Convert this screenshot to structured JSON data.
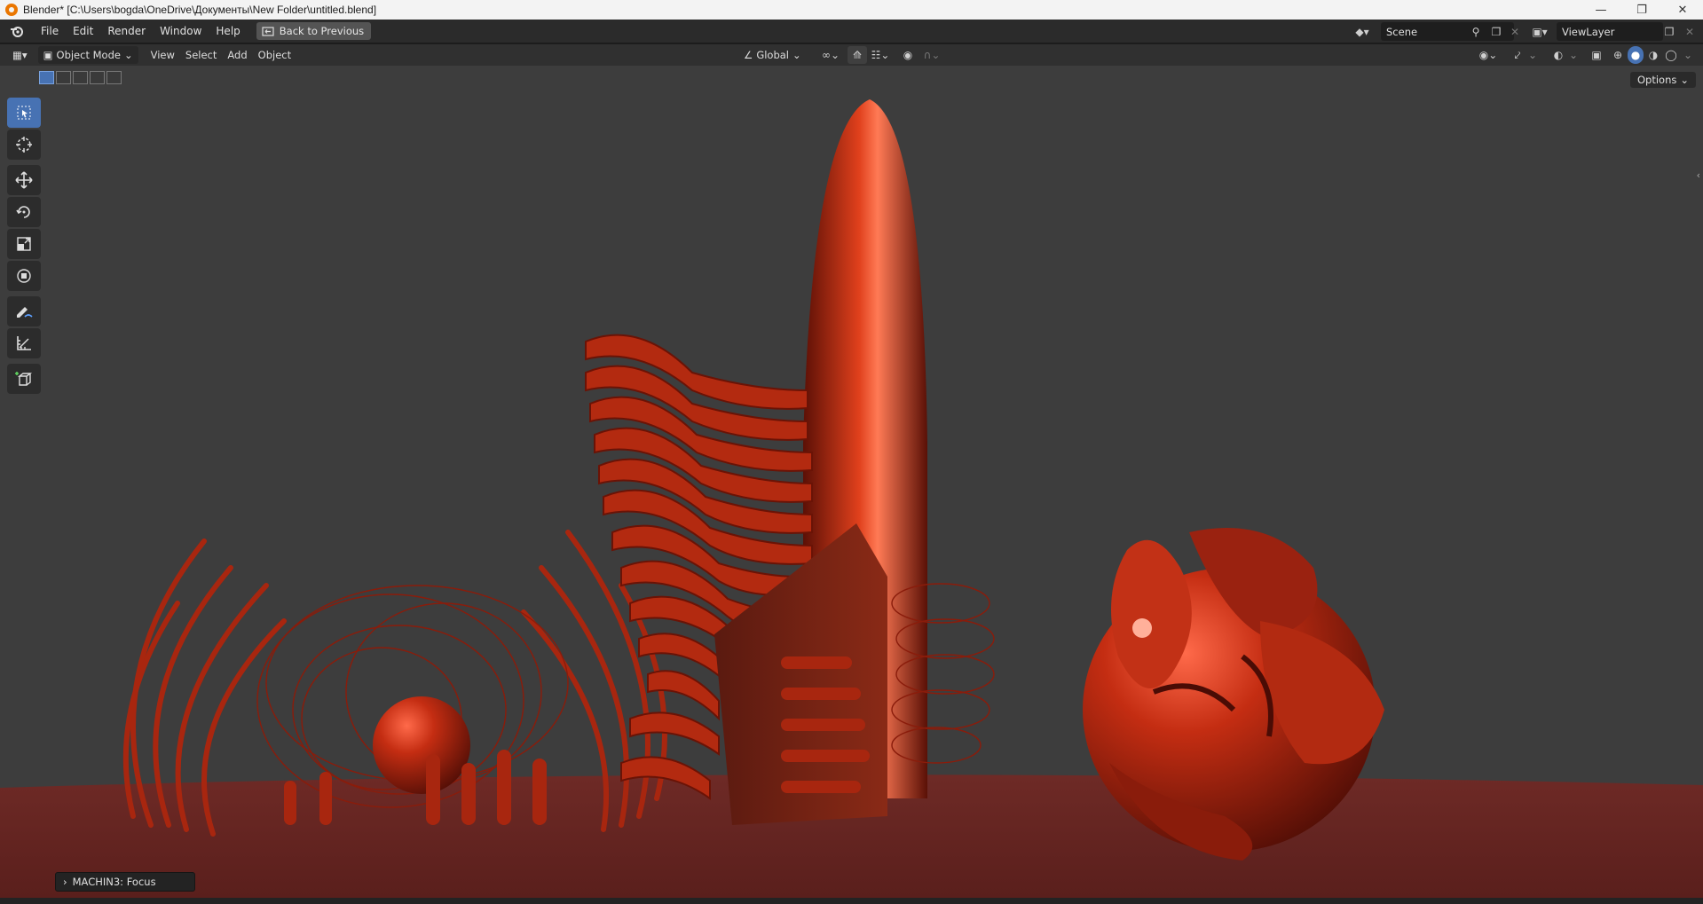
{
  "window": {
    "title": "Blender* [C:\\Users\\bogda\\OneDrive\\Документы\\New Folder\\untitled.blend]",
    "controls": [
      "minimize-icon",
      "maximize-icon",
      "close-icon"
    ]
  },
  "menu": {
    "items": [
      "File",
      "Edit",
      "Render",
      "Window",
      "Help"
    ],
    "back_label": "Back to Previous"
  },
  "scene": {
    "name": "Scene"
  },
  "view_layer": {
    "name": "ViewLayer"
  },
  "viewport_header": {
    "mode": "Object Mode",
    "menus": [
      "View",
      "Select",
      "Add",
      "Object"
    ],
    "transform_orientation": "Global",
    "options_label": "Options"
  },
  "toolbar": {
    "tools": [
      "select-box-icon",
      "cursor-icon",
      "move-icon",
      "rotate-icon",
      "scale-icon",
      "transform-icon",
      "annotate-icon",
      "measure-icon",
      "add-cube-icon"
    ]
  },
  "operator_panel": {
    "label": "MACHIN3: Focus"
  },
  "colors": {
    "accent": "#4772b3",
    "viewport_bg": "#3d3d3d",
    "floor": "#6a2a26",
    "object": "#c23116"
  }
}
